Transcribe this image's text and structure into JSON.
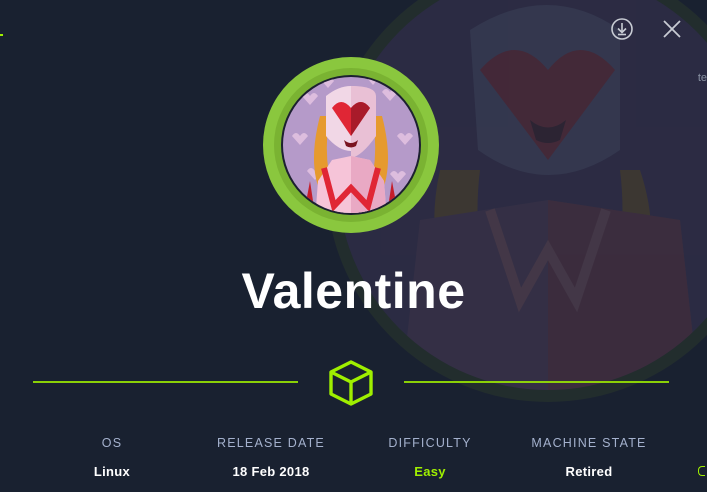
{
  "machine": {
    "name": "Valentine"
  },
  "actions": {
    "download_icon": "download-icon",
    "close_icon": "close-icon"
  },
  "stats": [
    {
      "label": "OS",
      "value": "Linux"
    },
    {
      "label": "RELEASE DATE",
      "value": "18 Feb 2018"
    },
    {
      "label": "DIFFICULTY",
      "value": "Easy"
    },
    {
      "label": "MACHINE STATE",
      "value": "Retired"
    }
  ],
  "edge_text": "te",
  "colors": {
    "background": "#1a2130",
    "accent": "#9fef00",
    "label": "#a4b1cd",
    "value": "#ffffff"
  }
}
